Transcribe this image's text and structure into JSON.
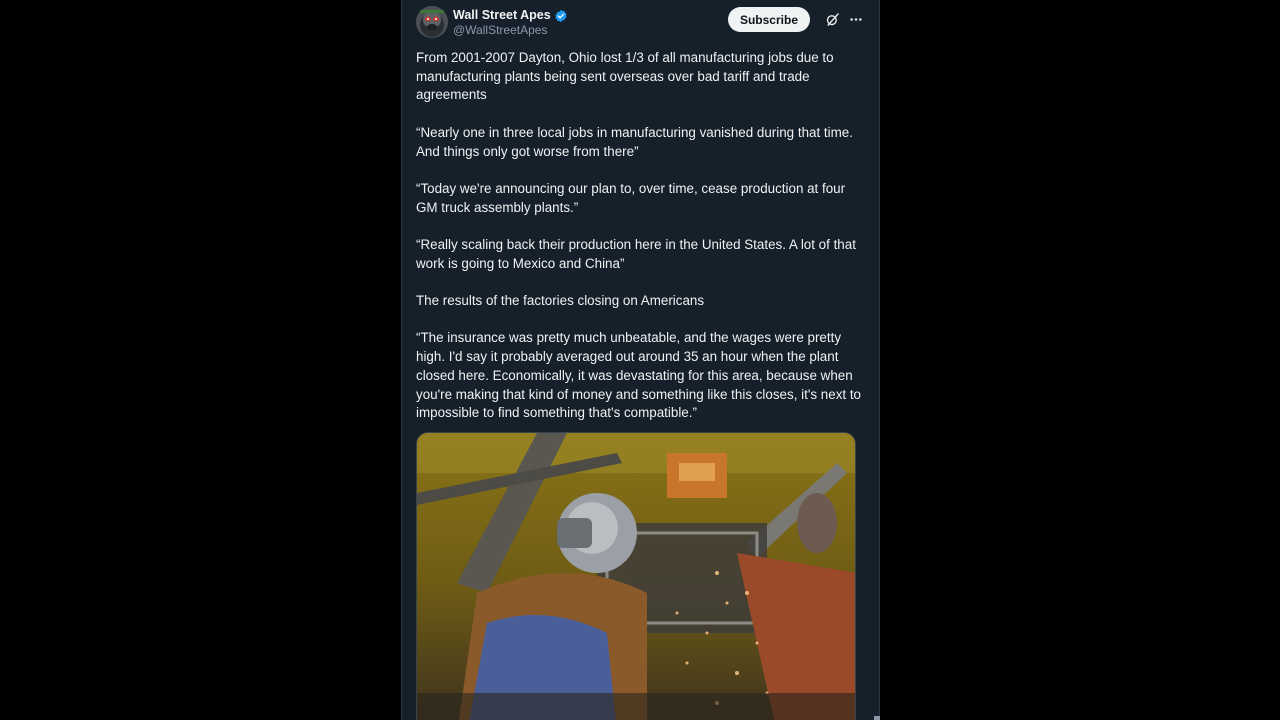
{
  "post": {
    "author": {
      "name": "Wall Street Apes",
      "handle": "@WallStreetApes",
      "verified": true,
      "avatar_icon": "gorilla-avatar-icon"
    },
    "actions": {
      "subscribe_label": "Subscribe",
      "grok_icon": "grok-icon",
      "more_icon": "more-options-icon"
    },
    "paragraphs": [
      "From 2001-2007 Dayton, Ohio lost 1/3 of all manufacturing jobs due to manufacturing plants being sent overseas over bad tariff and trade agreements",
      "“Nearly one in three local jobs in manufacturing vanished during that time. And things only got worse from there”",
      "“Today we're announcing our plan to, over time, cease production at four GM truck assembly plants.”",
      "“Really scaling back their production here in the United States. A lot of that work is going to Mexico and China”",
      "The results of the factories closing on Americans",
      "“The insurance was pretty much unbeatable, and the wages were pretty high. I'd say it probably averaged out around 35 an hour when the plant closed here. Economically, it was devastating for this area, because when you're making that kind of money and something like this closes, it's next to impossible to find something that's compatible.”"
    ],
    "media": {
      "type": "video",
      "subject": "factory-welding-scene"
    }
  },
  "colors": {
    "page_background": "#000000",
    "post_background": "#15202b",
    "text": "#e7e9ea",
    "secondary_text": "#8b98a5",
    "verified_blue": "#1d9bf0",
    "subscribe_bg": "#eff3f4"
  }
}
